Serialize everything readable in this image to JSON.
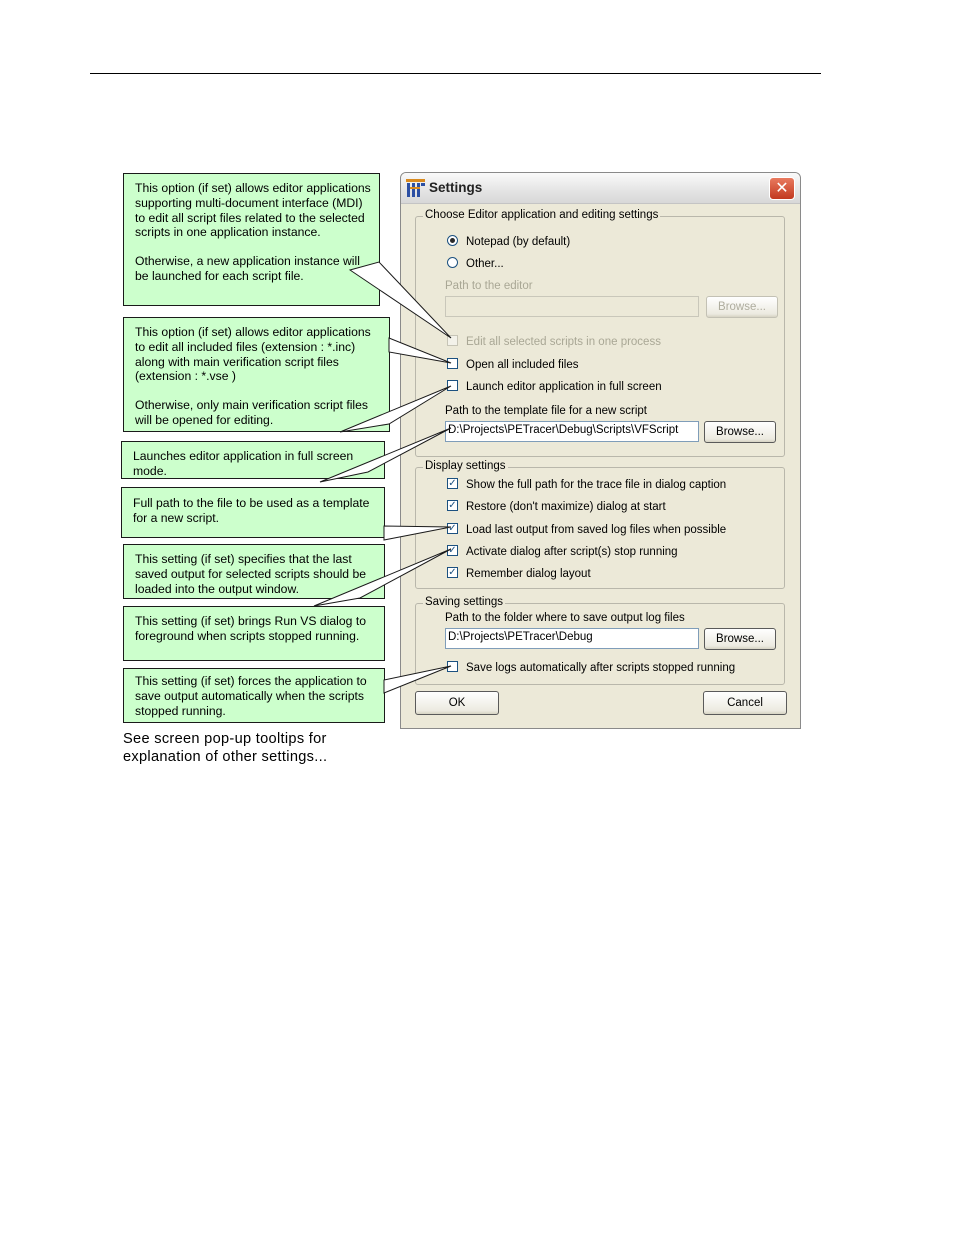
{
  "callouts": [
    {
      "paragraphs": [
        "This option (if set) allows editor applications supporting multi-document interface (MDI) to edit all script files related to the selected scripts in one application instance.",
        "Otherwise, a new application instance will be launched for each script file."
      ]
    },
    {
      "paragraphs": [
        "This option (if set) allows editor applications to edit all included files (extension : *.inc) along with main verification script files (extension :  *.vse )",
        "Otherwise, only main verification script files will be opened for editing."
      ]
    },
    {
      "paragraphs": [
        "Launches editor application in full screen mode."
      ]
    },
    {
      "paragraphs": [
        "Full path to the file to be used as a template for a new script."
      ]
    },
    {
      "paragraphs": [
        "This setting (if set) specifies that the last saved output for selected scripts should be loaded into the output window."
      ]
    },
    {
      "paragraphs": [
        "This setting (if set) brings Run VS dialog to foreground when scripts stopped running."
      ]
    },
    {
      "paragraphs": [
        "This setting (if set) forces the application to save output automatically when the scripts stopped running."
      ]
    }
  ],
  "caption": "See screen pop-up tooltips for explanation of other settings...",
  "dialog": {
    "title": "Settings",
    "close_glyph": "✕",
    "editor_group": {
      "label": "Choose Editor application and editing settings",
      "radio_notepad": {
        "label": "Notepad (by default)",
        "selected": true
      },
      "radio_other": {
        "label": "Other...",
        "selected": false
      },
      "path_label": "Path to the editor",
      "path_value": "",
      "browse_label": "Browse...",
      "edit_one_process": {
        "label": "Edit all selected scripts in one process",
        "checked": false,
        "enabled": false
      },
      "open_included": {
        "label": "Open all included files",
        "checked": false
      },
      "full_screen": {
        "label": "Launch editor application in full screen",
        "checked": false
      },
      "template_label": "Path to the template file for a new script",
      "template_value": "D:\\Projects\\PETracer\\Debug\\Scripts\\VFScript",
      "template_browse": "Browse..."
    },
    "display_group": {
      "label": "Display settings",
      "options": [
        {
          "label": "Show the full path for the trace file in dialog caption",
          "checked": true
        },
        {
          "label": "Restore (don't maximize) dialog at start",
          "checked": true
        },
        {
          "label": "Load last output from saved log files when possible",
          "checked": true
        },
        {
          "label": "Activate dialog after script(s) stop running",
          "checked": true
        },
        {
          "label": "Remember dialog layout",
          "checked": true
        }
      ]
    },
    "saving_group": {
      "label": "Saving settings",
      "folder_label": "Path to the folder where to save output log files",
      "folder_value": "D:\\Projects\\PETracer\\Debug",
      "browse_label": "Browse...",
      "auto_save": {
        "label": "Save logs automatically after scripts stopped running",
        "checked": false
      }
    },
    "ok_label": "OK",
    "cancel_label": "Cancel"
  }
}
